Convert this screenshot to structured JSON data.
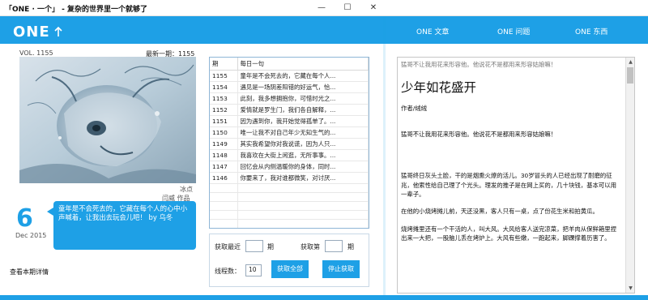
{
  "window": {
    "title": "「ONE · 一个」 - 复杂的世界里一个就够了",
    "min_label": "—",
    "max_label": "☐",
    "close_label": "✕"
  },
  "header": {
    "logo": "ONE",
    "nav": [
      "ONE 文章",
      "ONE 问题",
      "ONE 东西"
    ],
    "brand_color": "#1ea0e6"
  },
  "left": {
    "vol": "VOL. 1155",
    "latest_label": "最新一期：",
    "latest_value": "1155",
    "image_alt": "illustration-deer",
    "credit_name": "冰点",
    "credit_role": "闫威 作品",
    "day": "6",
    "month": "Dec 2015",
    "quote": "童年是不会死去的，它藏在每个人的心中小声喊着，让我出去玩会儿吧！ by 乌冬",
    "detail_link": "查看本期详情"
  },
  "table": {
    "headers": [
      "期",
      "每日一句"
    ],
    "rows": [
      [
        "1155",
        "童年是不会死去的，它藏在每个人..."
      ],
      [
        "1154",
        "遇见是一场阴差阳错的好运气，恰..."
      ],
      [
        "1153",
        "此刻，我多想拥抱你，可惜时光之..."
      ],
      [
        "1152",
        "爱情就是罗生门，我们各自解释，..."
      ],
      [
        "1151",
        "因为遇到你，我开始觉得孤单了。..."
      ],
      [
        "1150",
        "唯一让我不对自己年少无知生气的..."
      ],
      [
        "1149",
        "其实我希望你对我说谎，因为人只..."
      ],
      [
        "1148",
        "我喜欢在大街上闲逛，无所事事。..."
      ],
      [
        "1147",
        "回忆会从内侧温暖你的身体，同时..."
      ],
      [
        "1146",
        "你要来了，我对谁都微笑，对讨厌..."
      ]
    ],
    "empty_rows": 10
  },
  "controls": {
    "fetch_recent_label": "获取最近",
    "fetch_recent_value": "",
    "fetch_recent_unit": "期",
    "fetch_nth_label": "获取第",
    "fetch_nth_value": "",
    "fetch_nth_unit": "期",
    "threads_label": "线程数：",
    "threads_value": "10",
    "fetch_all_button": "获取全部",
    "stop_button": "停止获取"
  },
  "article": {
    "quote_top": "猛哥不让我用花来形容他。他说花不是都用来形容姑娘嘛！",
    "title": "少年如花盛开",
    "author": "作者/绒绒",
    "subtitle": "猛哥不让我用花来形容他。他说花不是都用来形容姑娘嘛！",
    "paragraphs": [
      "猛哥终日灰头土脸，干的是烟熏火燎的活儿。30岁冒头的人已经出现了耐磨的征兆，他索性给自己理了个光头。理发的推子是在网上买的，几十块钱，基本可以用一辈子。",
      "在他的小烧烤摊儿前，天还没黑，客人只有一桌，点了份花生米和拍黄瓜。",
      "烧烤摊里还有一个干活的人，叫大风。大风给客人送完凉菜，把羊肉从保鲜箱里捏出来一大把，一股脑儿丢在烤炉上。大风有些嫩，一跑起来，脚踝撑着历害了。"
    ]
  }
}
